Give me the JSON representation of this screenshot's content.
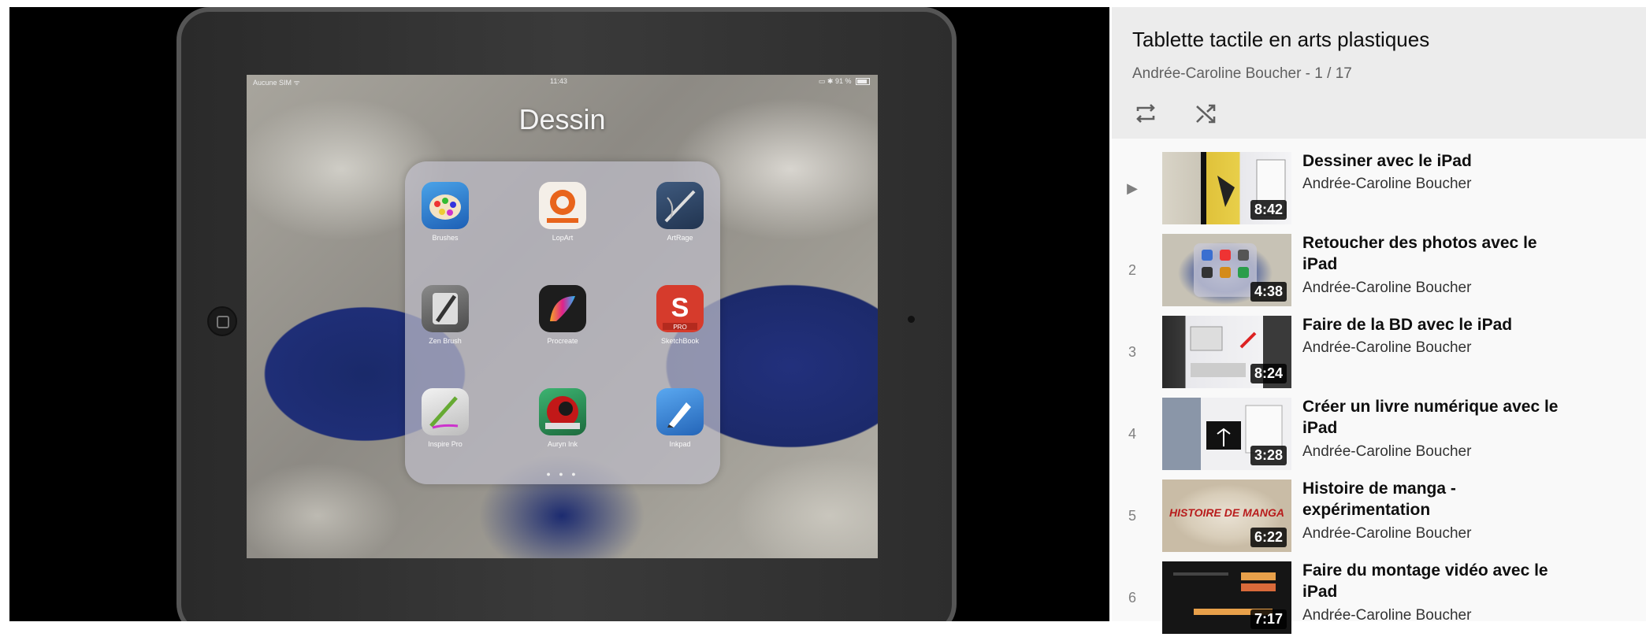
{
  "player": {
    "statusbar": {
      "carrier": "Aucune SIM ᯤ",
      "time": "11:43",
      "battery": "▭ ✱ 91 %"
    },
    "folder_title": "Dessin",
    "apps": [
      {
        "name": "Brushes"
      },
      {
        "name": "LopArt"
      },
      {
        "name": "ArtRage"
      },
      {
        "name": "Zen Brush"
      },
      {
        "name": "Procreate"
      },
      {
        "name": "SketchBook"
      },
      {
        "name": "Inspire Pro"
      },
      {
        "name": "Auryn Ink"
      },
      {
        "name": "Inkpad"
      }
    ],
    "page_dots": "● ● ●"
  },
  "playlist": {
    "title": "Tablette tactile en arts plastiques",
    "meta": "Andrée-Caroline Boucher - 1 / 17",
    "loop_icon": "loop-icon",
    "shuffle_icon": "shuffle-icon",
    "items": [
      {
        "index": "▶",
        "title": "Dessiner avec le iPad",
        "channel": "Andrée-Caroline Boucher",
        "duration": "8:42"
      },
      {
        "index": "2",
        "title": "Retoucher des photos avec le iPad",
        "channel": "Andrée-Caroline Boucher",
        "duration": "4:38"
      },
      {
        "index": "3",
        "title": "Faire de la BD avec le iPad",
        "channel": "Andrée-Caroline Boucher",
        "duration": "8:24"
      },
      {
        "index": "4",
        "title": "Créer un livre numérique avec le iPad",
        "channel": "Andrée-Caroline Boucher",
        "duration": "3:28"
      },
      {
        "index": "5",
        "title": "Histoire de manga - expérimentation",
        "channel": "Andrée-Caroline Boucher",
        "duration": "6:22",
        "thumb_text": "HISTOIRE DE MANGA"
      },
      {
        "index": "6",
        "title": "Faire du montage vidéo avec le iPad",
        "channel": "Andrée-Caroline Boucher",
        "duration": "7:17"
      }
    ]
  },
  "colors": {
    "header_bg": "#ececec",
    "panel_bg": "#f9f9f9",
    "player_bg": "#000000"
  }
}
